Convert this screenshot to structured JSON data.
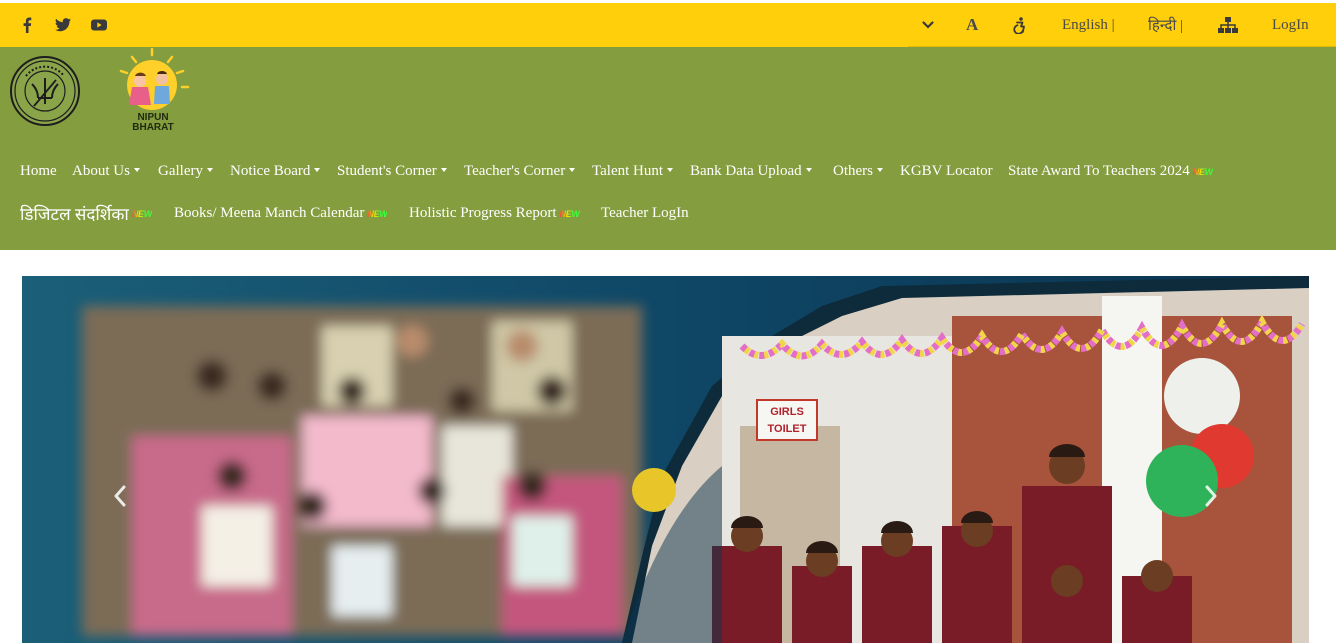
{
  "topbar": {
    "social": [
      {
        "icon": "facebook-icon"
      },
      {
        "icon": "twitter-icon"
      },
      {
        "icon": "youtube-icon"
      }
    ],
    "text_size_label": "A",
    "lang_english": "English |",
    "lang_hindi": "हिन्दी |",
    "login": "LogIn",
    "colors": {
      "bar": "#ffcf0c",
      "icon": "#3a3a3a"
    }
  },
  "header": {
    "nipun_logo_text": "NIPUN BHARAT",
    "nav_row1": [
      {
        "label": "Home",
        "dropdown": false,
        "isNew": false
      },
      {
        "label": "About Us",
        "dropdown": true,
        "isNew": false
      },
      {
        "label": "Gallery",
        "dropdown": true,
        "isNew": false
      },
      {
        "label": "Notice Board",
        "dropdown": true,
        "isNew": false
      },
      {
        "label": "Student's Corner",
        "dropdown": true,
        "isNew": false
      },
      {
        "label": "Teacher's Corner",
        "dropdown": true,
        "isNew": false
      },
      {
        "label": "Talent Hunt",
        "dropdown": true,
        "isNew": false
      },
      {
        "label": "Bank Data Upload",
        "dropdown": true,
        "isNew": false
      },
      {
        "label": "Others",
        "dropdown": true,
        "isNew": false
      },
      {
        "label": "KGBV Locator",
        "dropdown": false,
        "isNew": false
      },
      {
        "label": "State Award To Teachers 2024",
        "dropdown": false,
        "isNew": true
      }
    ],
    "nav_row2": [
      {
        "label": "डिजिटल संदर्शिका",
        "dropdown": false,
        "isNew": true
      },
      {
        "label": "Books/ Meena Manch Calendar",
        "dropdown": false,
        "isNew": true
      },
      {
        "label": "Holistic Progress Report",
        "dropdown": false,
        "isNew": true
      },
      {
        "label": "Teacher LogIn",
        "dropdown": false,
        "isNew": false
      }
    ],
    "new_badge": "NEW",
    "colors": {
      "background": "#849d3f",
      "nav_text": "#ffffff"
    }
  },
  "slider": {
    "sign_text": "GIRLS TOILET",
    "prev_icon": "chevron-left-icon",
    "next_icon": "chevron-right-icon"
  }
}
